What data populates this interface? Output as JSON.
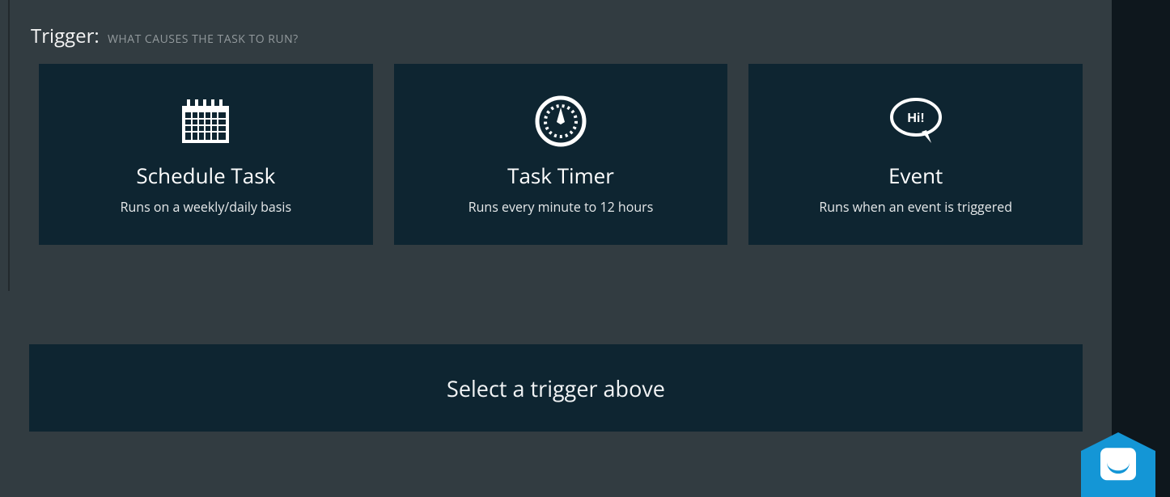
{
  "section": {
    "title": "Trigger:",
    "subtitle": "WHAT CAUSES THE TASK TO RUN?"
  },
  "cards": [
    {
      "title": "Schedule Task",
      "desc": "Runs on a weekly/daily basis"
    },
    {
      "title": "Task Timer",
      "desc": "Runs every minute to 12 hours"
    },
    {
      "title": "Event",
      "desc": "Runs when an event is triggered"
    }
  ],
  "info_bar": "Select a trigger above"
}
